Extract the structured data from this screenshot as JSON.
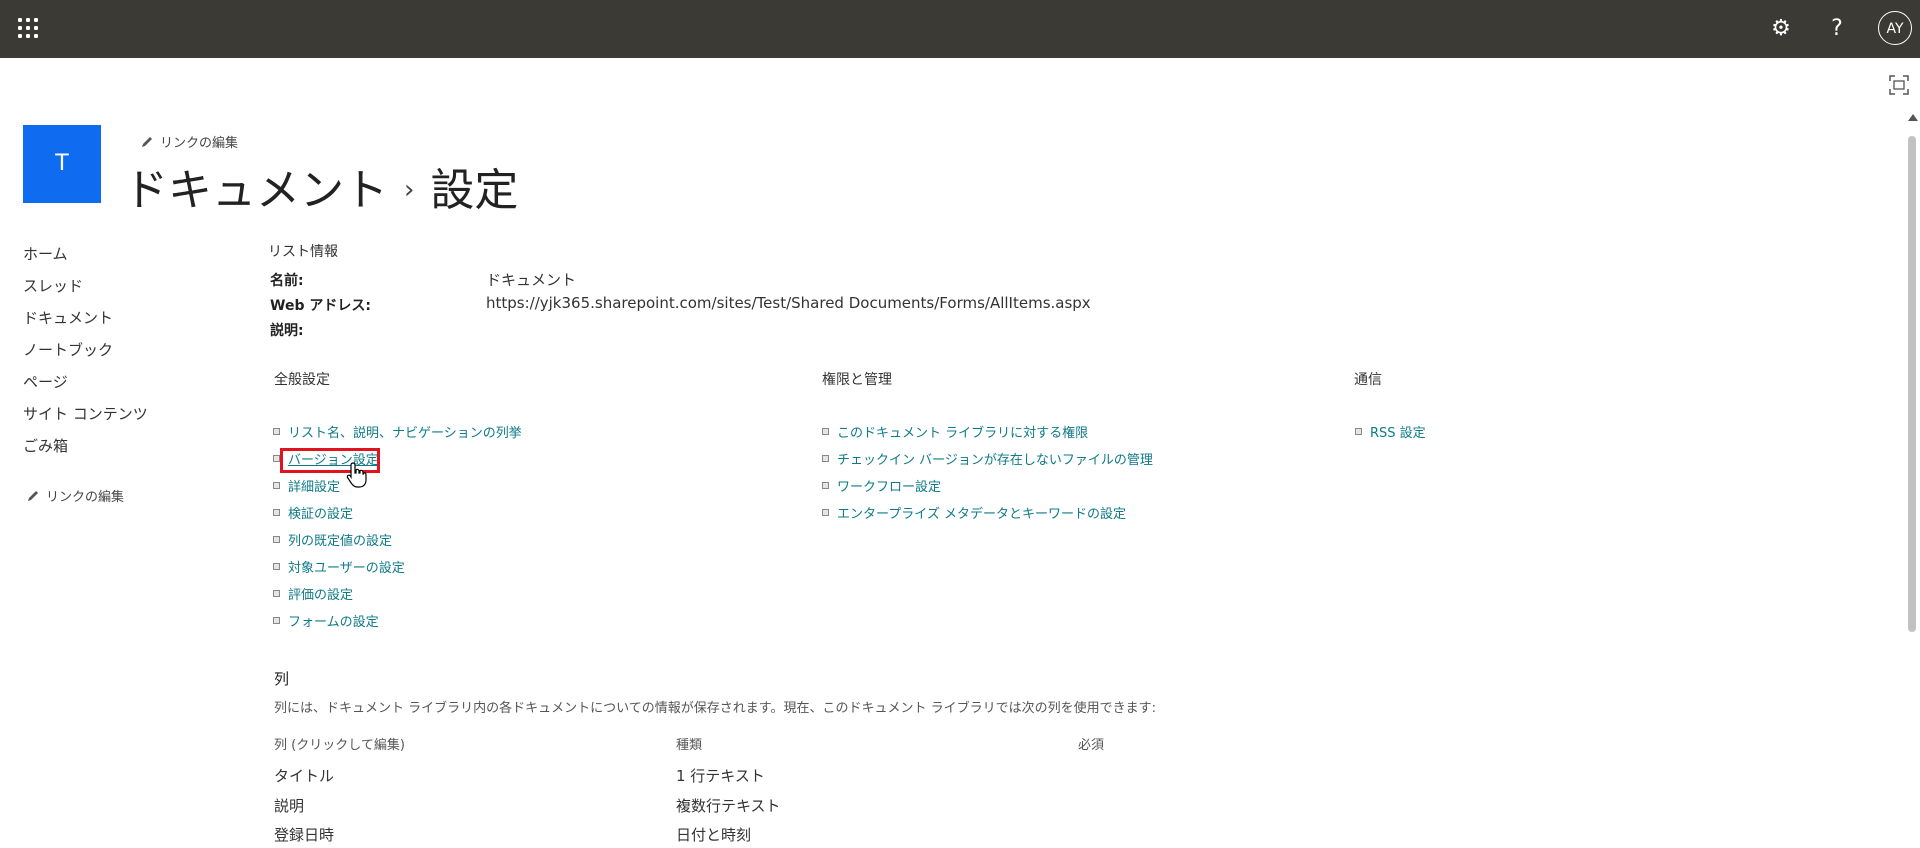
{
  "suite": {
    "avatar_initials": "AY",
    "settings_glyph": "⚙",
    "help_glyph": "?"
  },
  "site": {
    "logo_letter": "T",
    "edit_links_label": "リンクの編集",
    "title_part1": "ドキュメント",
    "title_separator": "›",
    "title_part2": "設定"
  },
  "left_nav": {
    "items": [
      "ホーム",
      "スレッド",
      "ドキュメント",
      "ノートブック",
      "ページ",
      "サイト コンテンツ",
      "ごみ箱"
    ],
    "edit_links_label": "リンクの編集"
  },
  "list_info": {
    "header": "リスト情報",
    "name_label": "名前:",
    "name_value": "ドキュメント",
    "web_label": "Web アドレス:",
    "web_value": "https://yjk365.sharepoint.com/sites/Test/Shared Documents/Forms/AllItems.aspx",
    "desc_label": "説明:"
  },
  "general": {
    "header": "全般設定",
    "links": [
      "リスト名、説明、ナビゲーションの列挙",
      "バージョン設定",
      "詳細設定",
      "検証の設定",
      "列の既定値の設定",
      "対象ユーザーの設定",
      "評価の設定",
      "フォームの設定"
    ]
  },
  "permissions": {
    "header": "権限と管理",
    "links": [
      "このドキュメント ライブラリに対する権限",
      "チェックイン バージョンが存在しないファイルの管理",
      "ワークフロー設定",
      "エンタープライズ メタデータとキーワードの設定"
    ]
  },
  "communications": {
    "header": "通信",
    "links": [
      "RSS 設定"
    ]
  },
  "columns": {
    "title": "列",
    "description": "列には、ドキュメント ライブラリ内の各ドキュメントについての情報が保存されます。現在、このドキュメント ライブラリでは次の列を使用できます:",
    "headers": [
      "列 (クリックして編集)",
      "種類",
      "必須"
    ],
    "rows": [
      {
        "name": "タイトル",
        "type": "1 行テキスト"
      },
      {
        "name": "説明",
        "type": "複数行テキスト"
      },
      {
        "name": "登録日時",
        "type": "日付と時刻"
      }
    ]
  },
  "colors": {
    "suitebar": "#3b3a35",
    "logo": "#0f6cf1",
    "link": "#0e7a88",
    "highlight": "#e0141e"
  }
}
